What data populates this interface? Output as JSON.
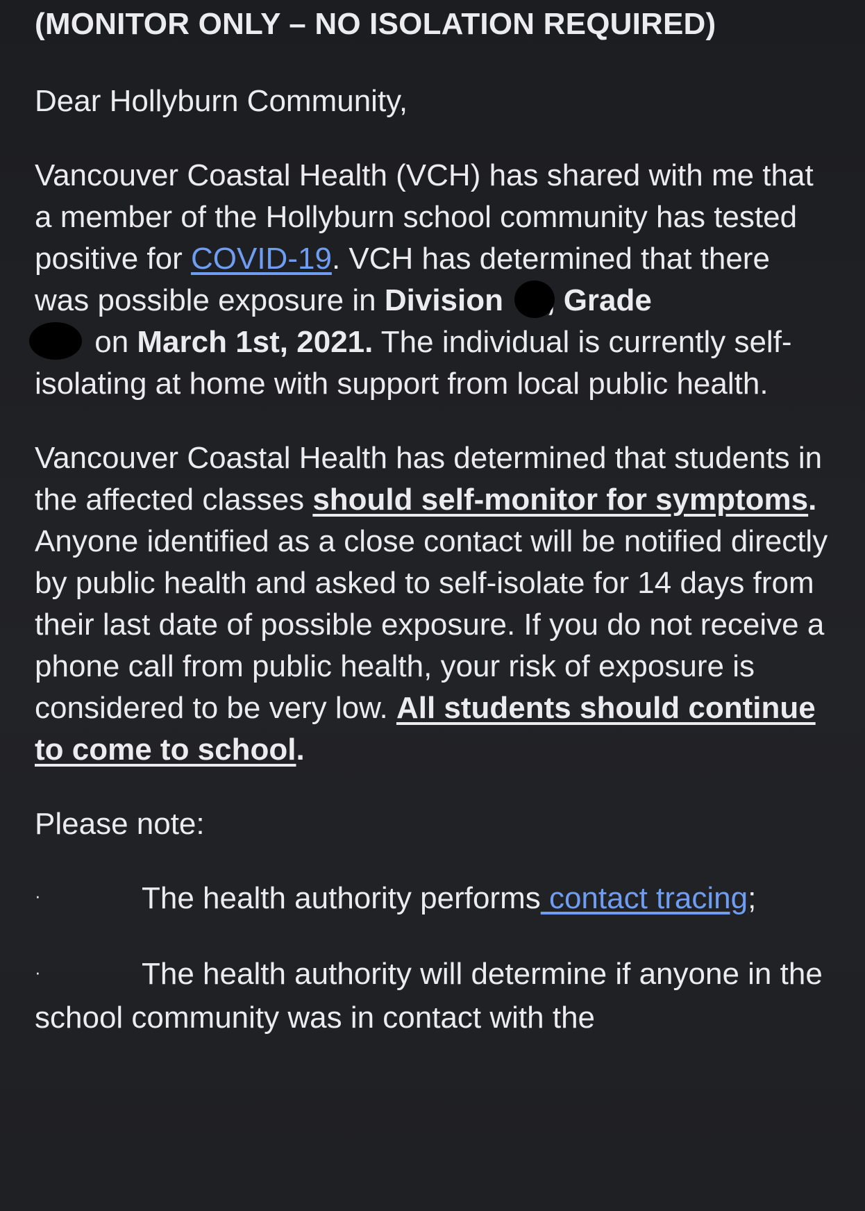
{
  "email": {
    "header": "(MONITOR ONLY – NO ISOLATION REQUIRED)",
    "greeting": "Dear Hollyburn Community,",
    "p1": {
      "a": "Vancouver Coastal Health (VCH) has shared with me that a member of the Hollyburn school community has tested positive for ",
      "link": "COVID-19",
      "b": ".   VCH has determined that there was possible exposure in ",
      "division": "Division",
      "comma": ",",
      "grade": " Grade",
      "c": " on ",
      "date": "March 1st, 2021.",
      "d": " The individual is currently self-isolating at home with support from local public health."
    },
    "p2": {
      "a": "Vancouver Coastal Health has determined that students in the affected classes ",
      "u1": "should self-monitor for symptoms",
      "dot": ".",
      "b": "  Anyone identified as a close contact will be notified directly by public health and asked to self-isolate for 14 days from their last date of possible exposure.  If you do not receive a phone call from public health, your risk of exposure is considered to be very low.  ",
      "u2": "All students should continue to come to school",
      "end": "."
    },
    "note": "Please note:",
    "bullets": [
      {
        "dot": "·",
        "text": "The health authority performs",
        "link": " contact tracing",
        "after": ";"
      },
      {
        "dot": "·",
        "text": "The health authority will determine if anyone in the school community was in contact with the",
        "link": "",
        "after": ""
      }
    ],
    "colors": {
      "background": "#1e1f23",
      "text": "#ececef",
      "link": "#6f9df2"
    }
  }
}
